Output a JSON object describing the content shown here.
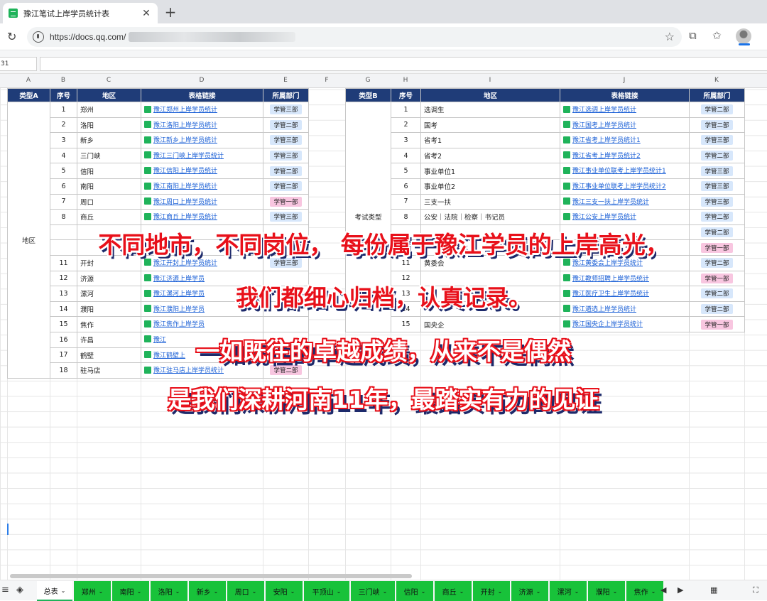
{
  "browser": {
    "tab_title": "豫江笔试上岸学员统计表",
    "url": "https://docs.qq.com/"
  },
  "formula_bar": {
    "name_box": "31"
  },
  "columns": [
    "A",
    "B",
    "C",
    "D",
    "E",
    "F",
    "G",
    "H",
    "I",
    "J",
    "K"
  ],
  "left_table": {
    "headers": [
      "类型A",
      "序号",
      "地区",
      "表格链接",
      "所属部门"
    ],
    "group_label": "地区",
    "rows": [
      {
        "no": "1",
        "region": "郑州",
        "link": "豫江郑州上岸学员统计",
        "dept": "学管三部",
        "tone": "blue"
      },
      {
        "no": "2",
        "region": "洛阳",
        "link": "豫江洛阳上岸学员统计",
        "dept": "学管二部",
        "tone": "blue"
      },
      {
        "no": "3",
        "region": "新乡",
        "link": "豫江新乡上岸学员统计",
        "dept": "学管三部",
        "tone": "blue"
      },
      {
        "no": "4",
        "region": "三门峡",
        "link": "豫江三门峡上岸学员统计",
        "dept": "学管三部",
        "tone": "blue"
      },
      {
        "no": "5",
        "region": "信阳",
        "link": "豫江信阳上岸学员统计",
        "dept": "学管二部",
        "tone": "blue"
      },
      {
        "no": "6",
        "region": "南阳",
        "link": "豫江南阳上岸学员统计",
        "dept": "学管二部",
        "tone": "blue"
      },
      {
        "no": "7",
        "region": "周口",
        "link": "豫江周口上岸学员统计",
        "dept": "学管一部",
        "tone": "pink"
      },
      {
        "no": "8",
        "region": "商丘",
        "link": "豫江商丘上岸学员统计",
        "dept": "学管三部",
        "tone": "blue"
      },
      {
        "no": "",
        "region": "",
        "link": "",
        "dept": "",
        "tone": "none"
      },
      {
        "no": "",
        "region": "",
        "link": "",
        "dept": "",
        "tone": "none"
      },
      {
        "no": "11",
        "region": "开封",
        "link": "豫江开封上岸学员统计",
        "dept": "学管三部",
        "tone": "blue"
      },
      {
        "no": "12",
        "region": "济源",
        "link": "豫江济源上岸学员",
        "dept": "",
        "tone": "none"
      },
      {
        "no": "13",
        "region": "漯河",
        "link": "豫江漯河上岸学员",
        "dept": "",
        "tone": "none"
      },
      {
        "no": "14",
        "region": "濮阳",
        "link": "豫江濮阳上岸学员",
        "dept": "",
        "tone": "none"
      },
      {
        "no": "15",
        "region": "焦作",
        "link": "豫江焦作上岸学员",
        "dept": "",
        "tone": "none"
      },
      {
        "no": "16",
        "region": "许昌",
        "link": "豫江",
        "dept": "",
        "tone": "none"
      },
      {
        "no": "17",
        "region": "鹤壁",
        "link": "豫江鹤壁上",
        "dept": "",
        "tone": "none"
      },
      {
        "no": "18",
        "region": "驻马店",
        "link": "豫江驻马店上岸学员统计",
        "dept": "学管二部",
        "tone": "pink"
      }
    ]
  },
  "right_table": {
    "headers": [
      "类型B",
      "序号",
      "地区",
      "表格链接",
      "所属部门"
    ],
    "group_label": "考试类型",
    "rows": [
      {
        "no": "1",
        "region": "选调生",
        "link": "豫江选调上岸学员统计",
        "dept": "学管二部",
        "tone": "blue"
      },
      {
        "no": "2",
        "region": "国考",
        "link": "豫江国考上岸学员统计",
        "dept": "学管二部",
        "tone": "blue"
      },
      {
        "no": "3",
        "region": "省考1",
        "link": "豫江省考上岸学员统计1",
        "dept": "学管三部",
        "tone": "blue"
      },
      {
        "no": "4",
        "region": "省考2",
        "link": "豫江省考上岸学员统计2",
        "dept": "学管二部",
        "tone": "blue"
      },
      {
        "no": "5",
        "region": "事业单位1",
        "link": "豫江事业单位联考上岸学员统计1",
        "dept": "学管三部",
        "tone": "blue"
      },
      {
        "no": "6",
        "region": "事业单位2",
        "link": "豫江事业单位联考上岸学员统计2",
        "dept": "学管三部",
        "tone": "blue"
      },
      {
        "no": "7",
        "region": "三支一扶",
        "link": "豫江三支一扶上岸学员统计",
        "dept": "学管三部",
        "tone": "blue"
      },
      {
        "no": "8",
        "region": "公安｜法院｜检察｜书记员",
        "link": "豫江公安上岸学员统计",
        "dept": "学管二部",
        "tone": "blue"
      },
      {
        "no": "",
        "region": "",
        "link": "",
        "dept": "学管二部",
        "tone": "blue"
      },
      {
        "no": "",
        "region": "",
        "link": "",
        "dept": "学管一部",
        "tone": "pink"
      },
      {
        "no": "11",
        "region": "黄委会",
        "link": "豫江黄委会上岸学员统计",
        "dept": "学管二部",
        "tone": "blue"
      },
      {
        "no": "12",
        "region": "",
        "link": "豫江教师招聘上岸学员统计",
        "dept": "学管一部",
        "tone": "pink"
      },
      {
        "no": "13",
        "region": "",
        "link": "豫江医疗卫生上岸学员统计",
        "dept": "学管二部",
        "tone": "blue"
      },
      {
        "no": "14",
        "region": "",
        "link": "豫江遴选上岸学员统计",
        "dept": "学管二部",
        "tone": "blue"
      },
      {
        "no": "15",
        "region": "国央企",
        "link": "豫江国央企上岸学员统计",
        "dept": "学管一部",
        "tone": "pink"
      }
    ]
  },
  "overlay": {
    "line1": "不同地市，不同岗位， 每份属于豫江学员的上岸高光，",
    "line2": "我们都细心归档，认真记录。",
    "line3": "一如既往的卓越成绩，从来不是偶然",
    "line4": "是我们深耕河南11年，最踏实有力的见证"
  },
  "sheet_tabs": [
    "总表",
    "郑州",
    "南阳",
    "洛阳",
    "新乡",
    "周口",
    "安阳",
    "平顶山",
    "三门峡",
    "信阳",
    "商丘",
    "开封",
    "济源",
    "漯河",
    "濮阳",
    "焦作"
  ],
  "colors": {
    "header_bg": "#1f3c78",
    "tab_green": "#18c23a",
    "overlay_red": "#e8101a",
    "shadow_navy": "#1d2a6b"
  }
}
